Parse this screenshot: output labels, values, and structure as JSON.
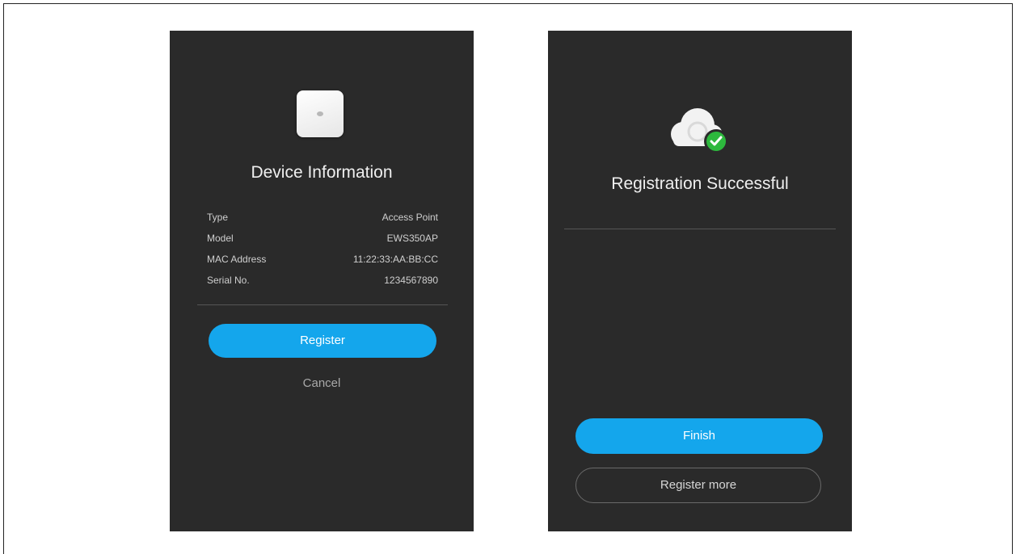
{
  "device_screen": {
    "title": "Device Information",
    "icon": "access-point-device-icon",
    "rows": [
      {
        "label": "Type",
        "value": "Access Point"
      },
      {
        "label": "Model",
        "value": "EWS350AP"
      },
      {
        "label": "MAC Address",
        "value": "11:22:33:AA:BB:CC"
      },
      {
        "label": "Serial No.",
        "value": "1234567890"
      }
    ],
    "register_label": "Register",
    "cancel_label": "Cancel"
  },
  "success_screen": {
    "title": "Registration Successful",
    "icon": "cloud-check-icon",
    "finish_label": "Finish",
    "register_more_label": "Register more"
  },
  "colors": {
    "screen_bg": "#2a2a2a",
    "primary_button": "#14a6ec",
    "success_check": "#2db83d"
  }
}
